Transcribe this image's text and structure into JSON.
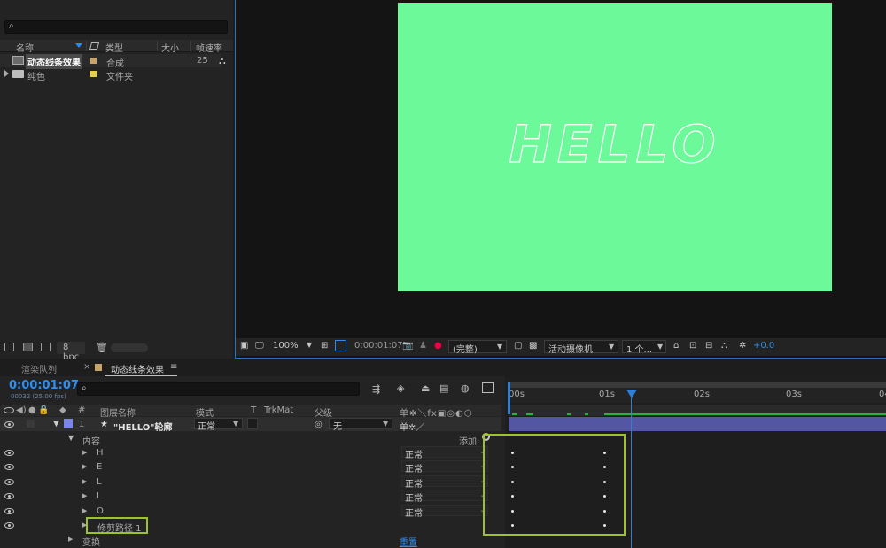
{
  "project": {
    "search_icon": "⌕",
    "columns": {
      "name": "名称",
      "type": "类型",
      "size": "大小",
      "framerate": "帧速率"
    },
    "items": [
      {
        "name": "动态线条效果",
        "type": "合成",
        "framerate": "25",
        "color": "#c9a46a",
        "icon": "composition-icon"
      },
      {
        "name": "纯色",
        "type": "文件夹",
        "framerate": "",
        "color": "#e4cf45",
        "icon": "folder-icon"
      }
    ],
    "footer": {
      "bpc": "8 bpc"
    }
  },
  "viewer": {
    "comp_text": "HELLO",
    "bg_color": "#6cf99a",
    "toolbar": {
      "zoom": "100%",
      "timecode": "0:00:01:07",
      "resolution": "(完整)",
      "camera": "活动摄像机",
      "views": "1 个...",
      "exposure": "+0.0"
    }
  },
  "timeline": {
    "tabs": {
      "render_queue": "渲染队列",
      "comp": "动态线条效果",
      "close": "×",
      "menu": "≡"
    },
    "timecode": "0:00:01:07",
    "frame_info": "00032 (25.00 fps)",
    "columns": {
      "num": "#",
      "layer_name": "图层名称",
      "mode": "模式",
      "t": "T",
      "trkmat": "TrkMat",
      "parent": "父级"
    },
    "layer": {
      "index": "1",
      "name": "\"HELLO\"轮廓",
      "mode": "正常",
      "parent": "无",
      "star": "★"
    },
    "contents": {
      "label": "内容",
      "add_label": "添加:"
    },
    "groups": [
      {
        "name": "H",
        "mode": "正常"
      },
      {
        "name": "E",
        "mode": "正常"
      },
      {
        "name": "L",
        "mode": "正常"
      },
      {
        "name": "L",
        "mode": "正常"
      },
      {
        "name": "O",
        "mode": "正常"
      }
    ],
    "trim_paths": "修剪路径 1",
    "transform": {
      "label": "变换",
      "reset": "重置"
    },
    "ruler": [
      "00s",
      "01s",
      "02s",
      "03s",
      "04"
    ],
    "highlight_color": "#9cc32a",
    "playhead_color": "#2f7fd6"
  }
}
